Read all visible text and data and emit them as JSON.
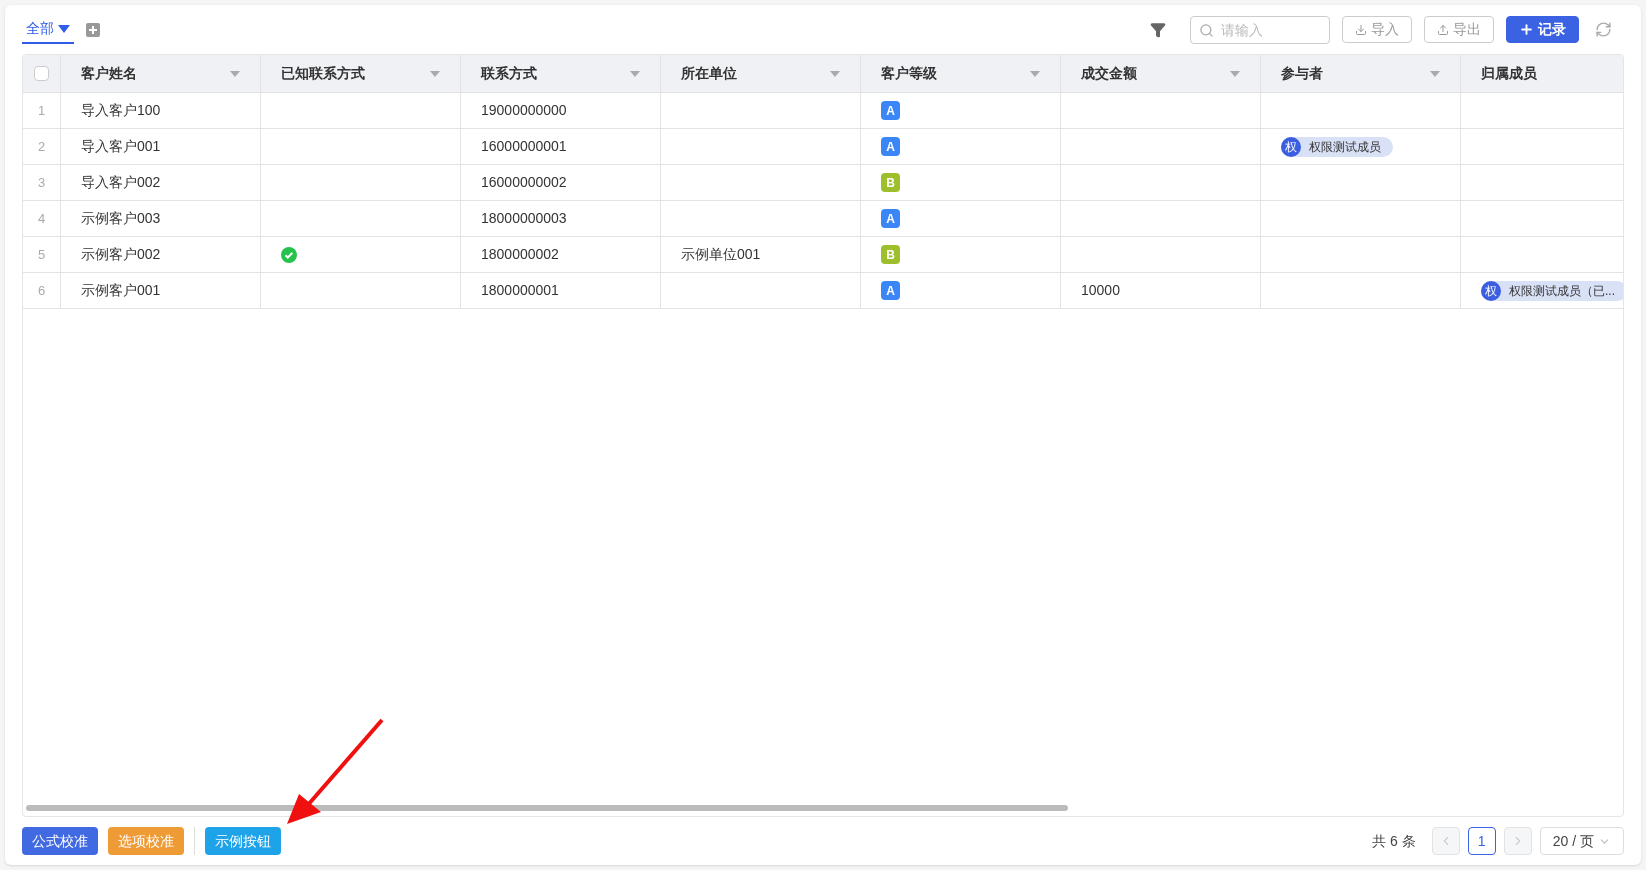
{
  "views": [
    {
      "label": "全部",
      "selected": true
    }
  ],
  "toolbar": {
    "search": {
      "placeholder": "请输入"
    },
    "buttons": [
      {
        "label": "导入",
        "kind": "outline"
      },
      {
        "label": "导出",
        "kind": "outline"
      },
      {
        "label": "记录",
        "kind": "primary"
      }
    ]
  },
  "table": {
    "select_all": {
      "checked": false
    },
    "columns": [
      {
        "label": "客户姓名"
      },
      {
        "label": "已知联系方式"
      },
      {
        "label": "联系方式"
      },
      {
        "label": "所在单位"
      },
      {
        "label": "客户等级"
      },
      {
        "label": "成交金额"
      },
      {
        "label": "参与者"
      },
      {
        "label": "归属成员"
      }
    ],
    "rows": [
      {
        "index": "1",
        "name": "导入客户100",
        "known_contact": false,
        "phone": "19000000000",
        "company": "",
        "level": {
          "label": "A",
          "color": "#3a86f6"
        },
        "amount": "",
        "participant": null,
        "owner": null
      },
      {
        "index": "2",
        "name": "导入客户001",
        "known_contact": false,
        "phone": "16000000001",
        "company": "",
        "level": {
          "label": "A",
          "color": "#3a86f6"
        },
        "amount": "",
        "participant": {
          "avatar": "权",
          "name": "权限测试成员"
        },
        "owner": null
      },
      {
        "index": "3",
        "name": "导入客户002",
        "known_contact": false,
        "phone": "16000000002",
        "company": "",
        "level": {
          "label": "B",
          "color": "#9dbf2c"
        },
        "amount": "",
        "participant": null,
        "owner": null
      },
      {
        "index": "4",
        "name": "示例客户003",
        "known_contact": false,
        "phone": "18000000003",
        "company": "",
        "level": {
          "label": "A",
          "color": "#3a86f6"
        },
        "amount": "",
        "participant": null,
        "owner": null
      },
      {
        "index": "5",
        "name": "示例客户002",
        "known_contact": true,
        "phone": "1800000002",
        "company": "示例单位001",
        "level": {
          "label": "B",
          "color": "#9dbf2c"
        },
        "amount": "",
        "participant": null,
        "owner": null
      },
      {
        "index": "6",
        "name": "示例客户001",
        "known_contact": false,
        "phone": "1800000001",
        "company": "",
        "level": {
          "label": "A",
          "color": "#3a86f6"
        },
        "amount": "10000",
        "participant": null,
        "owner": {
          "avatar": "权",
          "name": "权限测试成员（已..."
        }
      }
    ]
  },
  "button_groups": [
    [
      {
        "label": "公式校准",
        "color": "#4169e1"
      },
      {
        "label": "选项校准",
        "color": "#ee9a35"
      }
    ],
    [
      {
        "label": "示例按钮",
        "color": "#1fa3e8"
      }
    ]
  ],
  "pagination": {
    "total": "共 6 条",
    "prev_disabled": true,
    "next_disabled": true,
    "pages": [
      {
        "label": "1",
        "selected": true
      }
    ],
    "page_size": "20 / 页"
  }
}
